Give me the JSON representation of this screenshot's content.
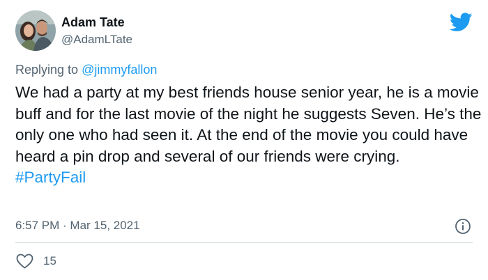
{
  "author": {
    "display_name": "Adam Tate",
    "handle": "@AdamLTate",
    "avatar_icon": "profile-photo"
  },
  "reply": {
    "prefix": "Replying to ",
    "mention": "@jimmyfallon"
  },
  "tweet": {
    "text": "We had a party at my best friends house senior year, he is a movie buff and for the last movie of the night he suggests Seven. He’s the only one who had seen it. At the end of the movie you could have heard a pin drop and several of our friends were crying.",
    "hashtag": "#PartyFail",
    "timestamp": "6:57 PM · Mar 15, 2021"
  },
  "stats": {
    "likes": "15"
  },
  "icons": {
    "brand": "twitter-bird-icon",
    "info": "info-icon",
    "like": "heart-icon"
  },
  "colors": {
    "brand": "#1d9bf0",
    "text": "#0f1419",
    "muted": "#536471",
    "divider": "#cfd9de"
  }
}
